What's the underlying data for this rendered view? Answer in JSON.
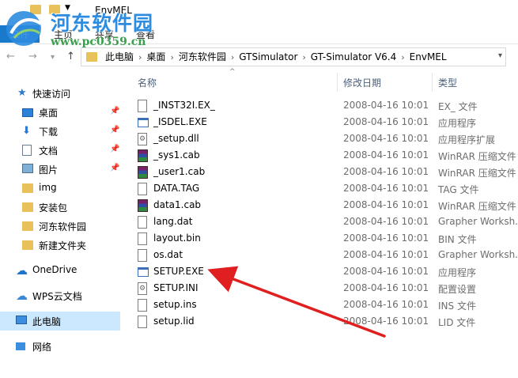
{
  "window": {
    "title": "EnvMEL"
  },
  "ribbon": {
    "tabs": [
      "文件",
      "主页",
      "共享",
      "查看"
    ]
  },
  "watermark": {
    "name": "河东软件园",
    "url": "www.pc0359.cn"
  },
  "nav": {
    "back": "←",
    "forward": "→",
    "recent": "▾",
    "up": "↑"
  },
  "address": {
    "crumbs": [
      "此电脑",
      "桌面",
      "河东软件园",
      "GTSimulator",
      "GT-Simulator V6.4",
      "EnvMEL"
    ],
    "separator": "›"
  },
  "sidebar": {
    "items": [
      {
        "label": "快速访问",
        "icon": "star-icon",
        "group": "top"
      },
      {
        "label": "桌面",
        "icon": "desktop-icon",
        "pinned": true
      },
      {
        "label": "下载",
        "icon": "download-icon",
        "pinned": true
      },
      {
        "label": "文档",
        "icon": "document-icon",
        "pinned": true
      },
      {
        "label": "图片",
        "icon": "picture-icon",
        "pinned": true
      },
      {
        "label": "img",
        "icon": "folder-icon"
      },
      {
        "label": "安装包",
        "icon": "folder-icon"
      },
      {
        "label": "河东软件园",
        "icon": "folder-icon"
      },
      {
        "label": "新建文件夹",
        "icon": "folder-icon"
      },
      {
        "label": "OneDrive",
        "icon": "cloud-icon",
        "group": "root"
      },
      {
        "label": "WPS云文档",
        "icon": "wps-cloud-icon",
        "group": "root"
      },
      {
        "label": "此电脑",
        "icon": "computer-icon",
        "group": "root",
        "active": true
      },
      {
        "label": "网络",
        "icon": "network-icon",
        "group": "root"
      }
    ],
    "pin_glyph": "📌"
  },
  "columns": {
    "name": "名称",
    "date": "修改日期",
    "type": "类型",
    "sort_glyph": "^"
  },
  "files": [
    {
      "name": "_INST32I.EX_",
      "date": "2008-04-16 10:01",
      "type": "EX_ 文件",
      "icon": "blank-file-icon"
    },
    {
      "name": "_ISDEL.EXE",
      "date": "2008-04-16 10:01",
      "type": "应用程序",
      "icon": "exe-icon"
    },
    {
      "name": "_setup.dll",
      "date": "2008-04-16 10:01",
      "type": "应用程序扩展",
      "icon": "dll-icon"
    },
    {
      "name": "_sys1.cab",
      "date": "2008-04-16 10:01",
      "type": "WinRAR 压缩文件",
      "icon": "winrar-icon"
    },
    {
      "name": "_user1.cab",
      "date": "2008-04-16 10:01",
      "type": "WinRAR 压缩文件",
      "icon": "winrar-icon"
    },
    {
      "name": "DATA.TAG",
      "date": "2008-04-16 10:01",
      "type": "TAG 文件",
      "icon": "blank-file-icon"
    },
    {
      "name": "data1.cab",
      "date": "2008-04-16 10:01",
      "type": "WinRAR 压缩文件",
      "icon": "winrar-icon"
    },
    {
      "name": "lang.dat",
      "date": "2008-04-16 10:01",
      "type": "Grapher Worksh...",
      "icon": "blank-file-icon"
    },
    {
      "name": "layout.bin",
      "date": "2008-04-16 10:01",
      "type": "BIN 文件",
      "icon": "blank-file-icon"
    },
    {
      "name": "os.dat",
      "date": "2008-04-16 10:01",
      "type": "Grapher Worksh...",
      "icon": "blank-file-icon"
    },
    {
      "name": "SETUP.EXE",
      "date": "2008-04-16 10:01",
      "type": "应用程序",
      "icon": "exe-icon"
    },
    {
      "name": "SETUP.INI",
      "date": "2008-04-16 10:01",
      "type": "配置设置",
      "icon": "ini-icon"
    },
    {
      "name": "setup.ins",
      "date": "2008-04-16 10:01",
      "type": "INS 文件",
      "icon": "blank-file-icon"
    },
    {
      "name": "setup.lid",
      "date": "2008-04-16 10:01",
      "type": "LID 文件",
      "icon": "blank-file-icon"
    }
  ],
  "colors": {
    "accent": "#1979ca",
    "selection": "#cce8ff",
    "folder": "#e8c15a",
    "annotation_arrow": "#e02020"
  }
}
